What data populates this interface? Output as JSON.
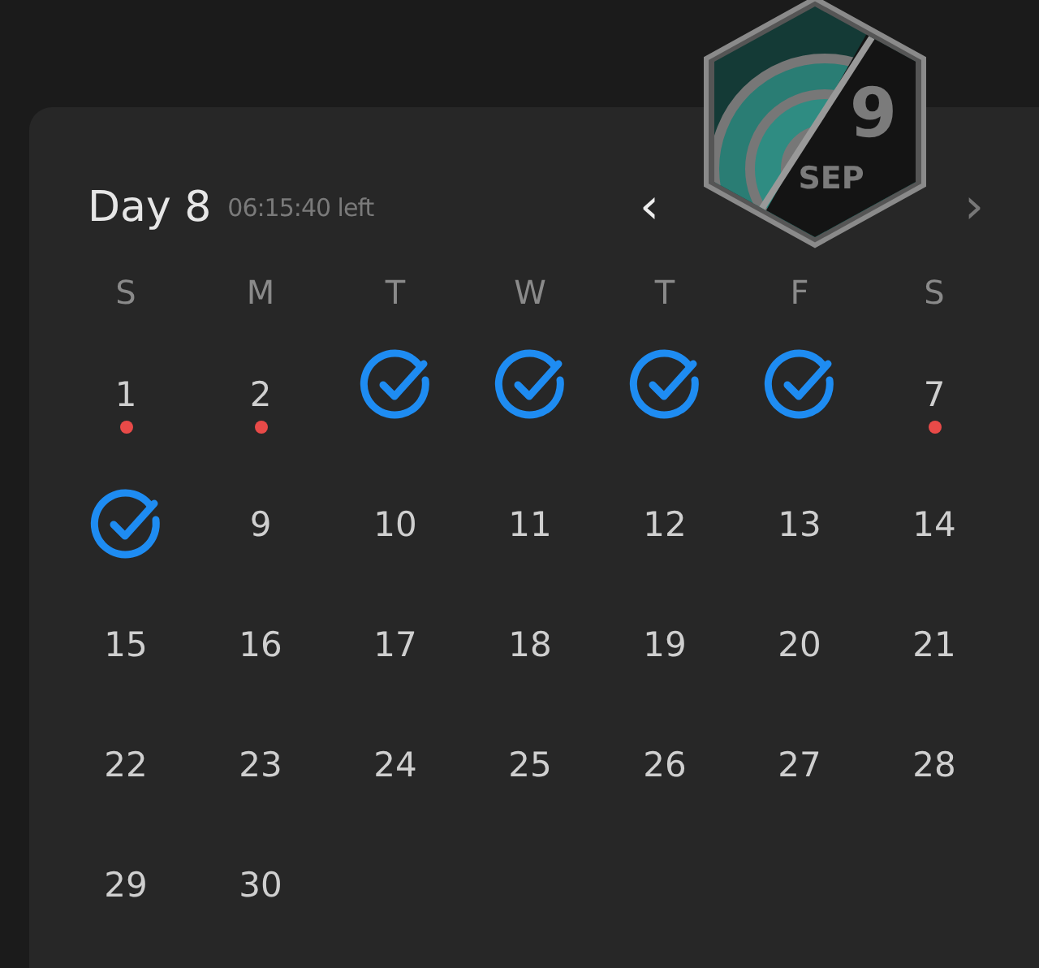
{
  "header": {
    "title": "Day 8",
    "countdown": "06:15:40 left",
    "prev": "‹",
    "next": "›"
  },
  "badge": {
    "day": "9",
    "month": "SEP"
  },
  "weekdays": [
    "S",
    "M",
    "T",
    "W",
    "T",
    "F",
    "S"
  ],
  "days": [
    {
      "kind": "missed",
      "label": "1"
    },
    {
      "kind": "missed",
      "label": "2"
    },
    {
      "kind": "done"
    },
    {
      "kind": "done"
    },
    {
      "kind": "done"
    },
    {
      "kind": "done"
    },
    {
      "kind": "missed",
      "label": "7"
    },
    {
      "kind": "done"
    },
    {
      "kind": "plain",
      "label": "9"
    },
    {
      "kind": "plain",
      "label": "10"
    },
    {
      "kind": "plain",
      "label": "11"
    },
    {
      "kind": "plain",
      "label": "12"
    },
    {
      "kind": "plain",
      "label": "13"
    },
    {
      "kind": "plain",
      "label": "14"
    },
    {
      "kind": "plain",
      "label": "15"
    },
    {
      "kind": "plain",
      "label": "16"
    },
    {
      "kind": "plain",
      "label": "17"
    },
    {
      "kind": "plain",
      "label": "18"
    },
    {
      "kind": "plain",
      "label": "19"
    },
    {
      "kind": "plain",
      "label": "20"
    },
    {
      "kind": "plain",
      "label": "21"
    },
    {
      "kind": "plain",
      "label": "22"
    },
    {
      "kind": "plain",
      "label": "23"
    },
    {
      "kind": "plain",
      "label": "24"
    },
    {
      "kind": "plain",
      "label": "25"
    },
    {
      "kind": "plain",
      "label": "26"
    },
    {
      "kind": "plain",
      "label": "27"
    },
    {
      "kind": "plain",
      "label": "28"
    },
    {
      "kind": "plain",
      "label": "29"
    },
    {
      "kind": "plain",
      "label": "30"
    }
  ]
}
